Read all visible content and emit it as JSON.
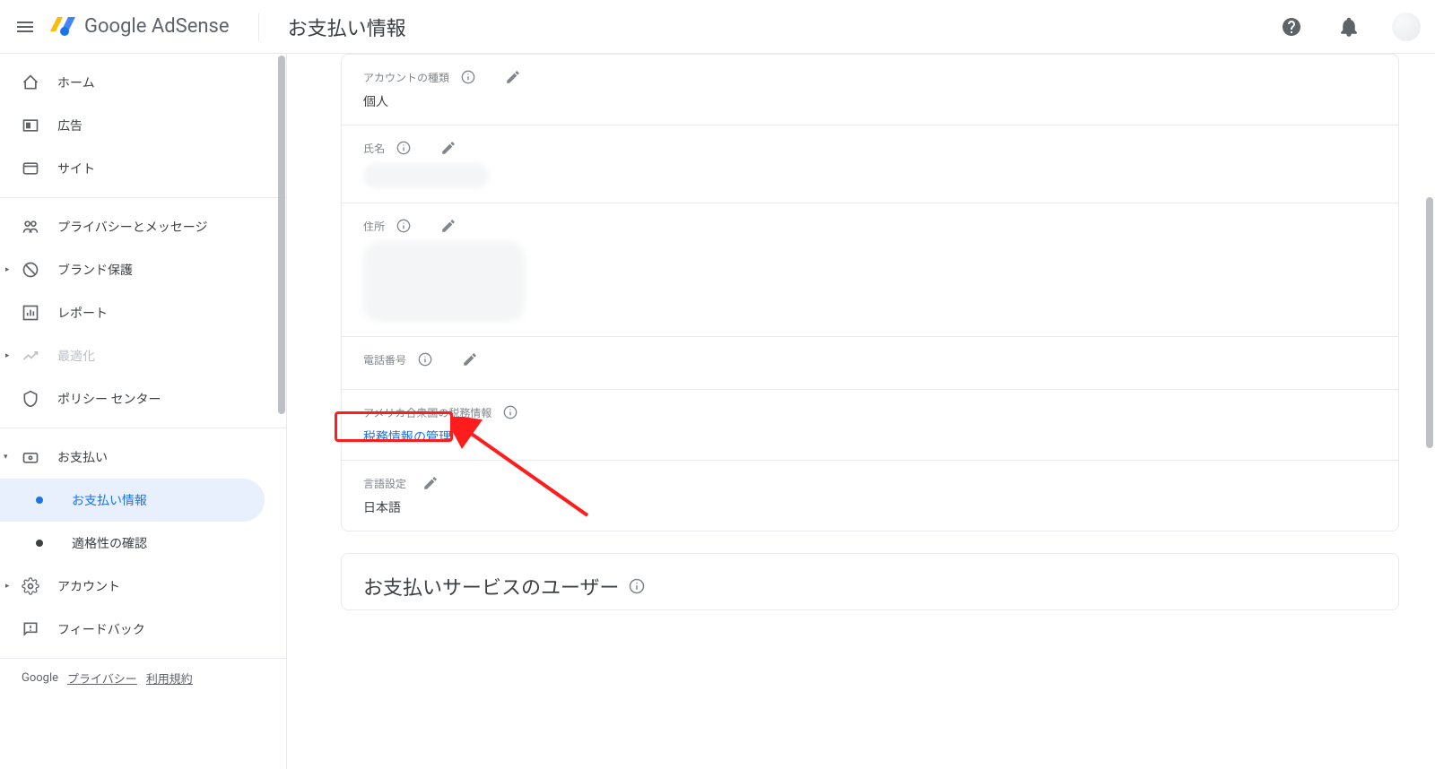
{
  "header": {
    "brand": "Google AdSense",
    "pageTitle": "お支払い情報"
  },
  "sidebar": {
    "items": [
      {
        "icon": "home",
        "label": "ホーム"
      },
      {
        "icon": "ads",
        "label": "広告"
      },
      {
        "icon": "site",
        "label": "サイト"
      }
    ],
    "items2": [
      {
        "icon": "privacy",
        "label": "プライバシーとメッセージ"
      },
      {
        "icon": "brand-protect",
        "label": "ブランド保護",
        "expandable": true
      },
      {
        "icon": "report",
        "label": "レポート"
      },
      {
        "icon": "optimize",
        "label": "最適化",
        "disabled": true,
        "expandable": true
      },
      {
        "icon": "policy",
        "label": "ポリシー センター"
      }
    ],
    "paymentsLabel": "お支払い",
    "paymentsSub": [
      {
        "label": "お支払い情報",
        "active": true
      },
      {
        "label": "適格性の確認",
        "active": false
      }
    ],
    "items3": [
      {
        "icon": "account",
        "label": "アカウント",
        "expandable": true
      },
      {
        "icon": "feedback",
        "label": "フィードバック"
      }
    ],
    "footer": {
      "google": "Google",
      "privacy": "プライバシー",
      "terms": "利用規約"
    }
  },
  "main": {
    "fields": {
      "accountType": {
        "label": "アカウントの種類",
        "value": "個人"
      },
      "name": {
        "label": "氏名"
      },
      "address": {
        "label": "住所"
      },
      "phone": {
        "label": "電話番号"
      },
      "usTax": {
        "label": "アメリカ合衆国の税務情報",
        "link": "税務情報の管理"
      },
      "language": {
        "label": "言語設定",
        "value": "日本語"
      }
    },
    "nextSection": "お支払いサービスのユーザー"
  }
}
